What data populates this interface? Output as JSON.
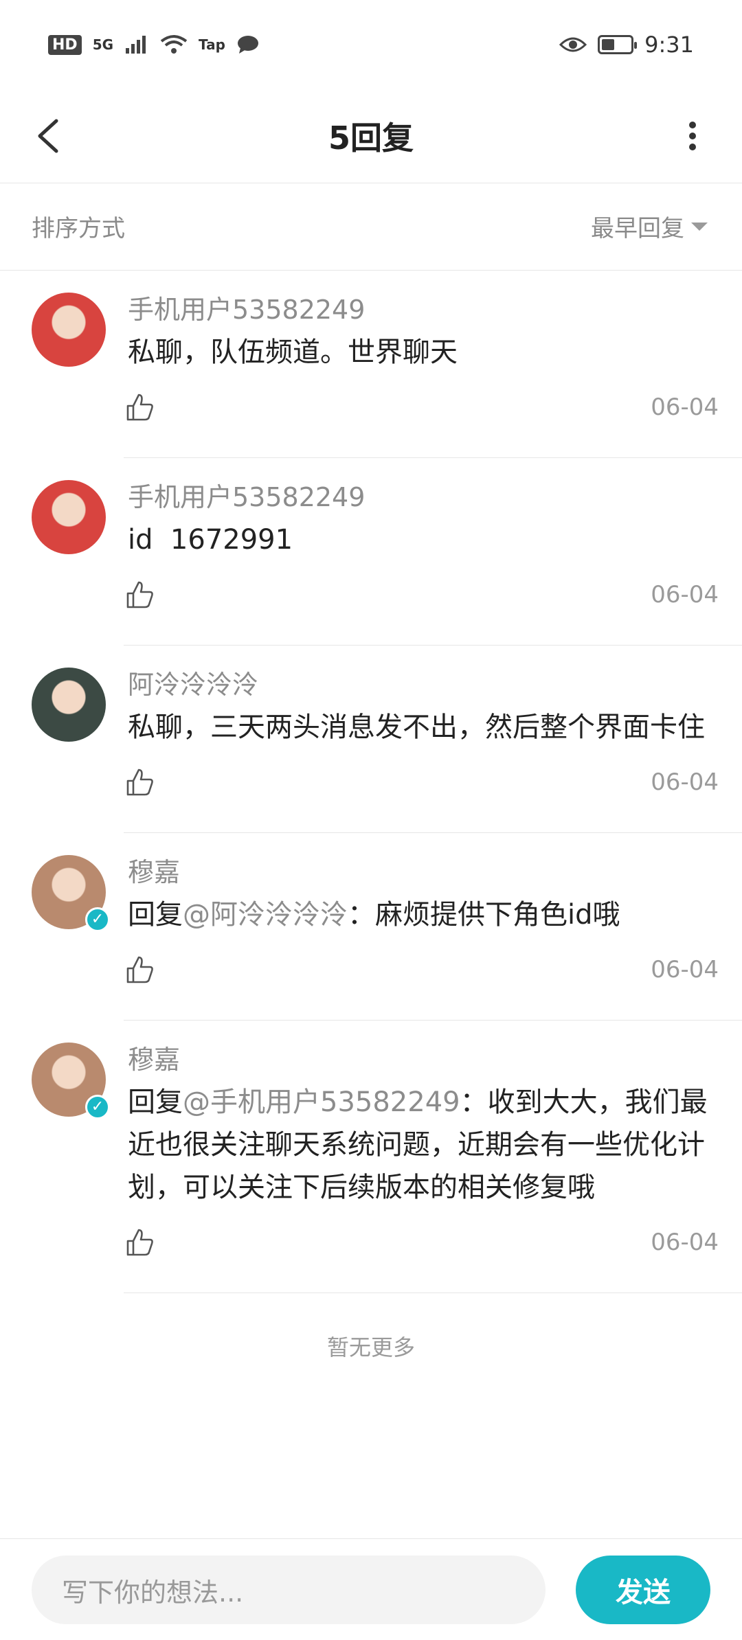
{
  "status_bar": {
    "hd_badge": "HD",
    "net": "5G",
    "tap_label": "Tap",
    "time": "9:31",
    "battery_level": 0.45
  },
  "header": {
    "title": "5回复",
    "back_icon": "chevron-left-icon",
    "more_icon": "more-vertical-icon"
  },
  "sort": {
    "label": "排序方式",
    "value": "最早回复"
  },
  "replies": [
    {
      "user": "手机用户53582249",
      "text": "私聊，队伍频道。世界聊天",
      "date": "06-04",
      "avatar_color": "#d8443f",
      "verified": false
    },
    {
      "user": "手机用户53582249",
      "text": "id  1672991",
      "date": "06-04",
      "avatar_color": "#d8443f",
      "verified": false
    },
    {
      "user": "阿泠泠泠泠",
      "text": "私聊，三天两头消息发不出，然后整个界面卡住",
      "date": "06-04",
      "avatar_color": "#3c4a44",
      "verified": false
    },
    {
      "user": "穆嘉",
      "text_prefix": "回复",
      "mention": "@阿泠泠泠泠",
      "text": "：麻烦提供下角色id哦",
      "date": "06-04",
      "avatar_color": "#b98a6e",
      "verified": true
    },
    {
      "user": "穆嘉",
      "text_prefix": "回复",
      "mention": "@手机用户53582249",
      "text": "：收到大大，我们最近也很关注聊天系统问题，近期会有一些优化计划，可以关注下后续版本的相关修复哦",
      "date": "06-04",
      "avatar_color": "#b98a6e",
      "verified": true
    }
  ],
  "footer": {
    "no_more": "暂无更多"
  },
  "composer": {
    "placeholder": "写下你的想法...",
    "send_label": "发送"
  },
  "colors": {
    "accent": "#19b8c6",
    "muted_text": "#8c8c8c"
  }
}
